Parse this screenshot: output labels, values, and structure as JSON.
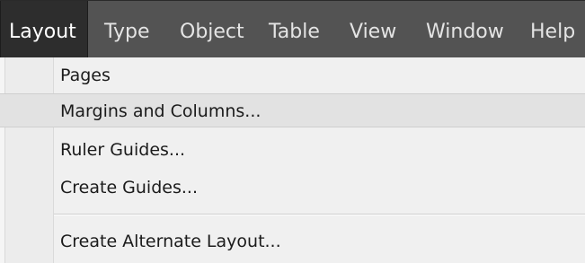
{
  "menubar": {
    "items": [
      {
        "label": "Layout",
        "active": true
      },
      {
        "label": "Type"
      },
      {
        "label": "Object"
      },
      {
        "label": "Table"
      },
      {
        "label": "View"
      },
      {
        "label": "Window"
      },
      {
        "label": "Help"
      }
    ]
  },
  "dropdown": {
    "items": [
      {
        "label": "Pages"
      },
      {
        "label": "Margins and Columns...",
        "highlighted": true
      },
      {
        "label": "Ruler Guides..."
      },
      {
        "label": "Create Guides..."
      },
      {
        "label": "Create Alternate Layout..."
      }
    ]
  },
  "colors": {
    "menubar_bg": "#535353",
    "menubar_active_bg": "#2d2d2d",
    "menubar_text": "#e4e4e4",
    "dropdown_bg": "#f0f0f0",
    "highlight_bg": "#e2e2e2",
    "item_text": "#1b1b1b"
  }
}
